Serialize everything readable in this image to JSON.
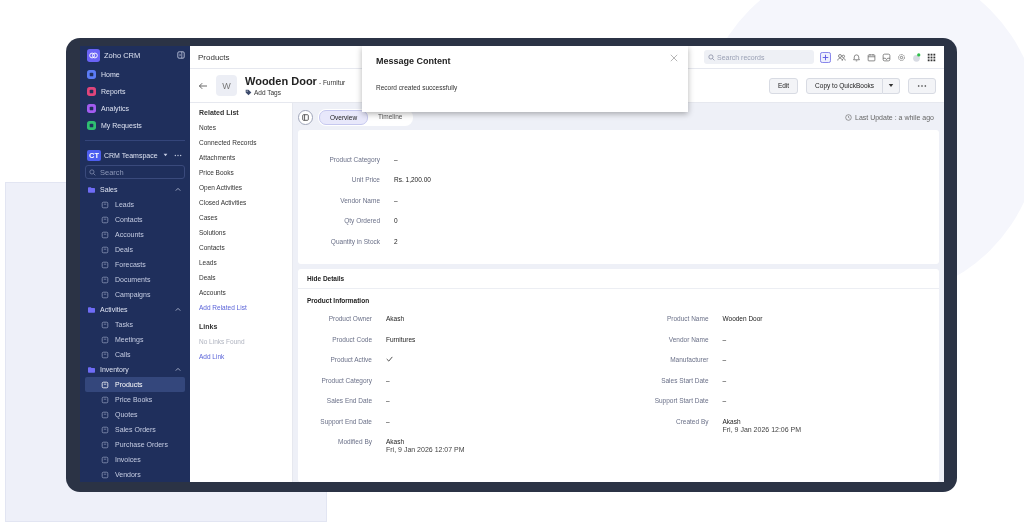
{
  "sidebar": {
    "app_name": "Zoho CRM",
    "nav": [
      {
        "label": "Home",
        "color": "#5b7cf7"
      },
      {
        "label": "Reports",
        "color": "#e0457b"
      },
      {
        "label": "Analytics",
        "color": "#a35cf0"
      },
      {
        "label": "My Requests",
        "color": "#2fbf71"
      }
    ],
    "teamspace": {
      "badge": "CT",
      "name": "CRM Teamspace"
    },
    "search": {
      "placeholder": "Search"
    },
    "groups": [
      {
        "label": "Sales",
        "expanded": true,
        "items": [
          {
            "label": "Leads",
            "selected": false
          },
          {
            "label": "Contacts",
            "selected": false
          },
          {
            "label": "Accounts",
            "selected": false
          },
          {
            "label": "Deals",
            "selected": false
          },
          {
            "label": "Forecasts",
            "selected": false
          },
          {
            "label": "Documents",
            "selected": false
          },
          {
            "label": "Campaigns",
            "selected": false
          }
        ]
      },
      {
        "label": "Activities",
        "expanded": true,
        "items": [
          {
            "label": "Tasks",
            "selected": false
          },
          {
            "label": "Meetings",
            "selected": false
          },
          {
            "label": "Calls",
            "selected": false
          }
        ]
      },
      {
        "label": "Inventory",
        "expanded": true,
        "items": [
          {
            "label": "Products",
            "selected": true
          },
          {
            "label": "Price Books",
            "selected": false
          },
          {
            "label": "Quotes",
            "selected": false
          },
          {
            "label": "Sales Orders",
            "selected": false
          },
          {
            "label": "Purchase Orders",
            "selected": false
          },
          {
            "label": "Invoices",
            "selected": false
          },
          {
            "label": "Vendors",
            "selected": false
          }
        ]
      }
    ]
  },
  "topbar": {
    "title": "Products",
    "search": {
      "placeholder": "Search records"
    }
  },
  "record": {
    "avatar": "W",
    "name": "Wooden Door",
    "subtitle": "- Furnitur",
    "add_tags": "Add Tags",
    "buttons": [
      "Edit",
      "Copy to QuickBooks"
    ]
  },
  "related_list": {
    "title": "Related List",
    "items": [
      "Notes",
      "Connected Records",
      "Attachments",
      "Price Books",
      "Open Activities",
      "Closed Activities",
      "Cases",
      "Solutions",
      "Contacts",
      "Leads",
      "Deals",
      "Accounts"
    ],
    "add": "Add Related List",
    "links_title": "Links",
    "links_empty": "No Links Found",
    "add_link": "Add Link"
  },
  "tabs": [
    {
      "label": "Overview",
      "selected": true
    },
    {
      "label": "Timeline",
      "selected": false
    }
  ],
  "last_update": "Last Update : a while ago",
  "summary": [
    {
      "label": "Product Category",
      "value": "–"
    },
    {
      "label": "Unit Price",
      "value": "Rs. 1,200.00"
    },
    {
      "label": "Vendor Name",
      "value": "–"
    },
    {
      "label": "Qty Ordered",
      "value": "0"
    },
    {
      "label": "Quantity in Stock",
      "value": "2"
    }
  ],
  "details": {
    "toggle": "Hide Details",
    "section": "Product Information",
    "fields": [
      {
        "kind": "text",
        "label": "Product Owner",
        "value": "Akash"
      },
      {
        "kind": "text",
        "label": "Product Name",
        "value": "Wooden Door"
      },
      {
        "kind": "text",
        "label": "Product Code",
        "value": "Furnitures"
      },
      {
        "kind": "text",
        "label": "Vendor Name",
        "value": "–"
      },
      {
        "kind": "check",
        "label": "Product Active",
        "checked": true
      },
      {
        "kind": "text",
        "label": "Manufacturer",
        "value": "–"
      },
      {
        "kind": "text",
        "label": "Product Category",
        "value": "–"
      },
      {
        "kind": "text",
        "label": "Sales Start Date",
        "value": "–"
      },
      {
        "kind": "text",
        "label": "Sales End Date",
        "value": "–"
      },
      {
        "kind": "text",
        "label": "Support Start Date",
        "value": "–"
      },
      {
        "kind": "text",
        "label": "Support End Date",
        "value": "–"
      },
      {
        "kind": "user",
        "label": "Created By",
        "value": "Akash",
        "date": "Fri, 9 Jan 2026 12:06 PM"
      },
      {
        "kind": "user",
        "label": "Modified By",
        "value": "Akash",
        "date": "Fri, 9 Jan 2026 12:07 PM"
      }
    ]
  },
  "message": {
    "title": "Message Content",
    "text": "Record created successfully"
  }
}
